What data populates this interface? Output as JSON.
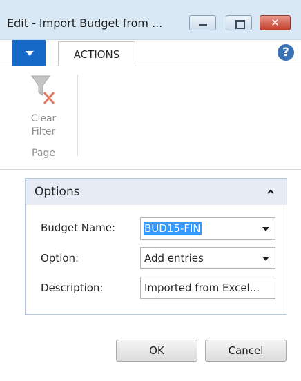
{
  "window": {
    "title": "Edit - Import Budget from ...",
    "controls": {
      "minimize_icon": "minimize-icon",
      "maximize_icon": "maximize-icon",
      "close_icon": "close-icon",
      "close_glyph": "✕"
    }
  },
  "ribbon": {
    "tabs": [
      {
        "label": "ACTIONS",
        "selected": true
      }
    ],
    "help_glyph": "?",
    "groups": [
      {
        "label": "Page",
        "actions": [
          {
            "label_line1": "Clear",
            "label_line2": "Filter",
            "icon": "clear-filter-icon",
            "enabled": false
          }
        ]
      }
    ]
  },
  "options": {
    "title": "Options",
    "collapsed": false,
    "fields": [
      {
        "label": "Budget Name:",
        "value": "BUD15-FIN",
        "type": "dropdown",
        "selected_text": true
      },
      {
        "label": "Option:",
        "value": "Add entries",
        "type": "dropdown"
      },
      {
        "label": "Description:",
        "value": "Imported from Excel...",
        "type": "text"
      }
    ]
  },
  "buttons": {
    "ok": "OK",
    "cancel": "Cancel"
  },
  "colors": {
    "accent": "#1568c6",
    "title_bar": "#d9e8f5",
    "panel_header": "#e5ecf5",
    "selection": "#3399ff",
    "close_button": "#c4402c"
  }
}
